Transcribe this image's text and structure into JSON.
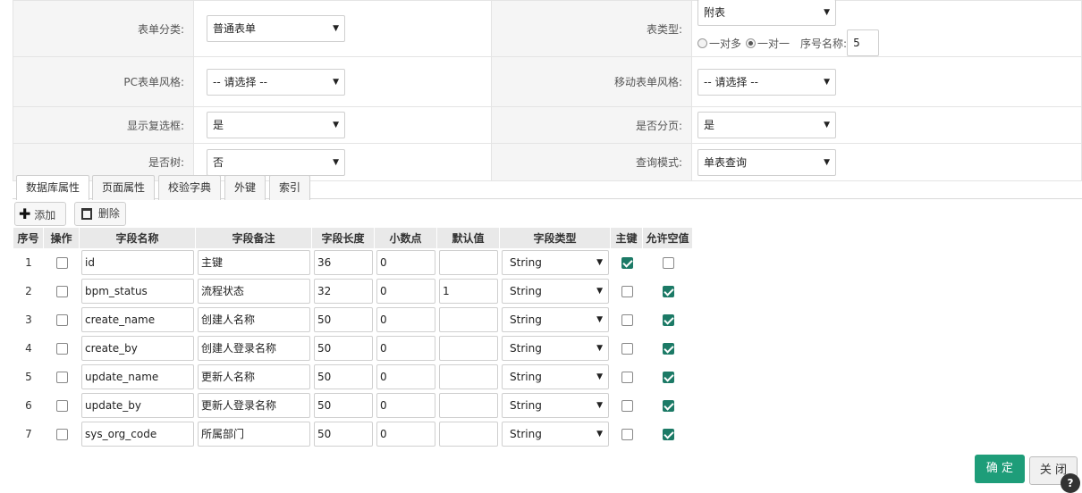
{
  "form": {
    "rows": [
      {
        "left_label": "表单分类:",
        "left_value": "普通表单",
        "right_label": "表类型:",
        "right_value": "附表"
      },
      {
        "left_label": "PC表单风格:",
        "left_value": "-- 请选择 --",
        "right_label": "移动表单风格:",
        "right_value": "-- 请选择 --"
      },
      {
        "left_label": "显示复选框:",
        "left_value": "是",
        "right_label": "是否分页:",
        "right_value": "是"
      },
      {
        "left_label": "是否树:",
        "left_value": "否",
        "right_label": "查询模式:",
        "right_value": "单表查询"
      }
    ],
    "relation": {
      "one_to_many": "一对多",
      "one_to_one": "一对一",
      "selected": "一对一",
      "seq_label": "序号名称:",
      "seq_value": "5"
    }
  },
  "tabs": [
    "数据库属性",
    "页面属性",
    "校验字典",
    "外键",
    "索引"
  ],
  "toolbar": {
    "add_label": "添加",
    "delete_label": "删除"
  },
  "grid": {
    "headers": [
      "序号",
      "操作",
      "字段名称",
      "字段备注",
      "字段长度",
      "小数点",
      "默认值",
      "字段类型",
      "主键",
      "允许空值"
    ],
    "rows": [
      {
        "no": "1",
        "name": "id",
        "comment": "主键",
        "length": "36",
        "decimal": "0",
        "default": "",
        "type": "String",
        "pk": true,
        "nullable": false
      },
      {
        "no": "2",
        "name": "bpm_status",
        "comment": "流程状态",
        "length": "32",
        "decimal": "0",
        "default": "1",
        "type": "String",
        "pk": false,
        "nullable": true
      },
      {
        "no": "3",
        "name": "create_name",
        "comment": "创建人名称",
        "length": "50",
        "decimal": "0",
        "default": "",
        "type": "String",
        "pk": false,
        "nullable": true
      },
      {
        "no": "4",
        "name": "create_by",
        "comment": "创建人登录名称",
        "length": "50",
        "decimal": "0",
        "default": "",
        "type": "String",
        "pk": false,
        "nullable": true
      },
      {
        "no": "5",
        "name": "update_name",
        "comment": "更新人名称",
        "length": "50",
        "decimal": "0",
        "default": "",
        "type": "String",
        "pk": false,
        "nullable": true
      },
      {
        "no": "6",
        "name": "update_by",
        "comment": "更新人登录名称",
        "length": "50",
        "decimal": "0",
        "default": "",
        "type": "String",
        "pk": false,
        "nullable": true
      },
      {
        "no": "7",
        "name": "sys_org_code",
        "comment": "所属部门",
        "length": "50",
        "decimal": "0",
        "default": "",
        "type": "String",
        "pk": false,
        "nullable": true
      }
    ]
  },
  "footer": {
    "ok_label": "确 定",
    "close_label": "关 闭"
  },
  "colors": {
    "accent": "#1e9d79",
    "checked": "#1c7a66"
  }
}
